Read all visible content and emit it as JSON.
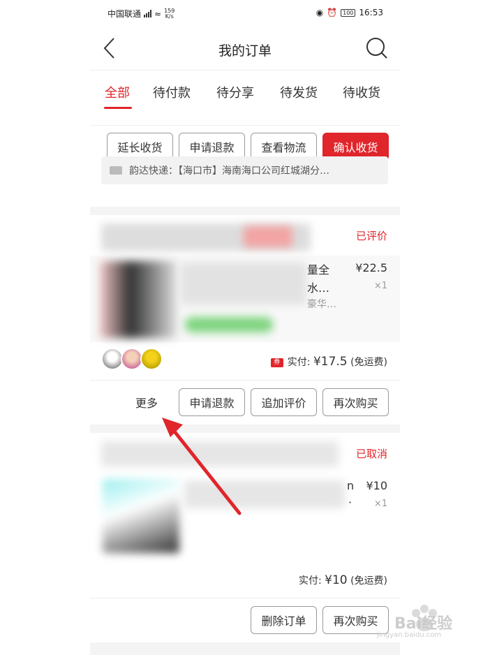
{
  "status_bar": {
    "carrier": "中国联通",
    "speed_value": "159",
    "speed_unit": "K/s",
    "battery": "100",
    "time": "16:53"
  },
  "nav": {
    "title": "我的订单",
    "back_icon": "chevron-left-icon",
    "search_icon": "search-icon"
  },
  "tabs": [
    "全部",
    "待付款",
    "待分享",
    "待发货",
    "待收货"
  ],
  "order1": {
    "buttons": [
      "延长收货",
      "申请退款",
      "查看物流",
      "确认收货"
    ],
    "logistics": "韵达快递：【海口市】海南海口公司红城湖分…"
  },
  "order2": {
    "status": "已评价",
    "product_frag1": "量全",
    "product_frag2": "水…",
    "product_frag3": "豪华…",
    "price": "¥22.5",
    "qty": "×1",
    "coupon_label": "券",
    "paid_label": "实付: ",
    "paid_amount": "¥17.5",
    "shipping": "(免运费)",
    "more": "更多",
    "buttons": [
      "申请退款",
      "追加评价",
      "再次购买"
    ]
  },
  "order3": {
    "status": "已取消",
    "product_frag": "n",
    "product_frag2": "·",
    "price": "¥10",
    "qty": "×1",
    "paid_label": "实付: ",
    "paid_amount": "¥10",
    "shipping": "(免运费)",
    "buttons": [
      "删除订单",
      "再次购买"
    ]
  },
  "watermark": {
    "text": "Bai经验",
    "sub": "jingyan.baidu.com"
  },
  "colors": {
    "accent": "#e0252b",
    "background": "#f4f4f4"
  }
}
